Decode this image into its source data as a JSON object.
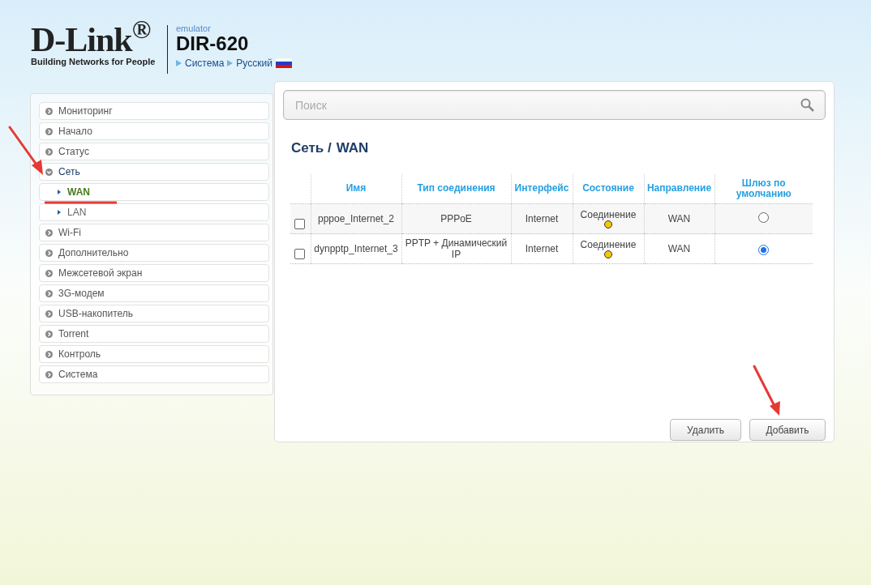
{
  "header": {
    "logo": "D-Link$^{®}$",
    "tagline": "Building Networks for People",
    "emulator_label": "emulator",
    "model": "DIR-620",
    "links": [
      "Система",
      "Русский"
    ]
  },
  "sidebar": {
    "items": [
      {
        "label": "Мониторинг",
        "expanded": false
      },
      {
        "label": "Начало",
        "expanded": false
      },
      {
        "label": "Статус",
        "expanded": false
      },
      {
        "label": "Сеть",
        "expanded": true,
        "children": [
          {
            "label": "WAN",
            "selected": true
          },
          {
            "label": "LAN",
            "selected": false
          }
        ]
      },
      {
        "label": "Wi-Fi",
        "expanded": false
      },
      {
        "label": "Дополнительно",
        "expanded": false
      },
      {
        "label": "Межсетевой экран",
        "expanded": false
      },
      {
        "label": "3G-модем",
        "expanded": false
      },
      {
        "label": "USB-накопитель",
        "expanded": false
      },
      {
        "label": "Torrent",
        "expanded": false
      },
      {
        "label": "Контроль",
        "expanded": false
      },
      {
        "label": "Система",
        "expanded": false
      }
    ]
  },
  "search": {
    "placeholder": "Поиск"
  },
  "breadcrumb": [
    "Сеть /",
    "WAN"
  ],
  "table": {
    "columns": [
      "Имя",
      "Тип соединения",
      "Интерфейс",
      "Состояние",
      "Направление",
      "Шлюз по умолчанию"
    ],
    "rows": [
      {
        "checked": false,
        "name": "pppoe_Internet_2",
        "type": "PPPoE",
        "interface": "Internet",
        "state": "Соединение",
        "color": "#f5c800",
        "direction": "WAN",
        "default_gateway": false
      },
      {
        "checked": false,
        "name": "dynpptp_Internet_3",
        "type": "PPTP + Динамический IP",
        "interface": "Internet",
        "state": "Соединение",
        "color": "#f5c800",
        "direction": "WAN",
        "default_gateway": true
      }
    ]
  },
  "buttons": [
    "Удалить",
    "Добавить"
  ]
}
